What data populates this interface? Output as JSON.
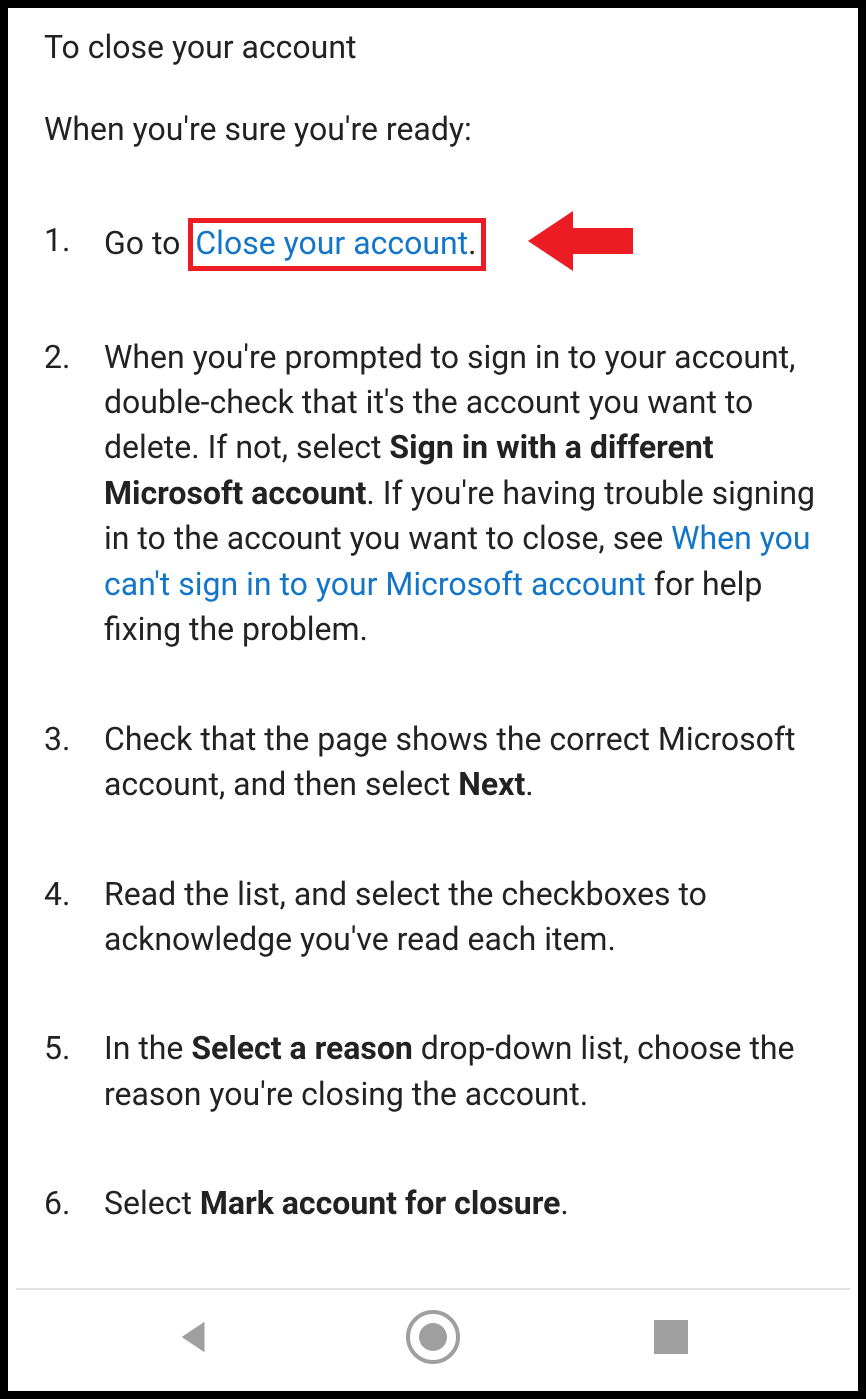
{
  "heading": "To close your account",
  "intro": "When you're sure you're ready:",
  "steps": {
    "s1": {
      "prefix": "Go to",
      "link": "Close your account",
      "suffix": "."
    },
    "s2": {
      "a": "When you're prompted to sign in to your account, double-check that it's the account you want to delete. If not, select ",
      "bold1": "Sign in with a different Microsoft account",
      "b": ". If you're having trouble signing in to the account you want to close, see ",
      "link": "When you can't sign in to your Microsoft account",
      "c": " for help fixing the problem."
    },
    "s3": {
      "a": "Check that the page shows the correct Microsoft account, and then select ",
      "bold1": "Next",
      "b": "."
    },
    "s4": {
      "a": "Read the list, and select the checkboxes to acknowledge you've read each item."
    },
    "s5": {
      "a": "In the ",
      "bold1": "Select a reason",
      "b": " drop-down list, choose the reason you're closing the account."
    },
    "s6": {
      "a": "Select ",
      "bold1": "Mark account for closure",
      "b": "."
    }
  },
  "annotation": {
    "arrow_color": "#ed1c24"
  }
}
